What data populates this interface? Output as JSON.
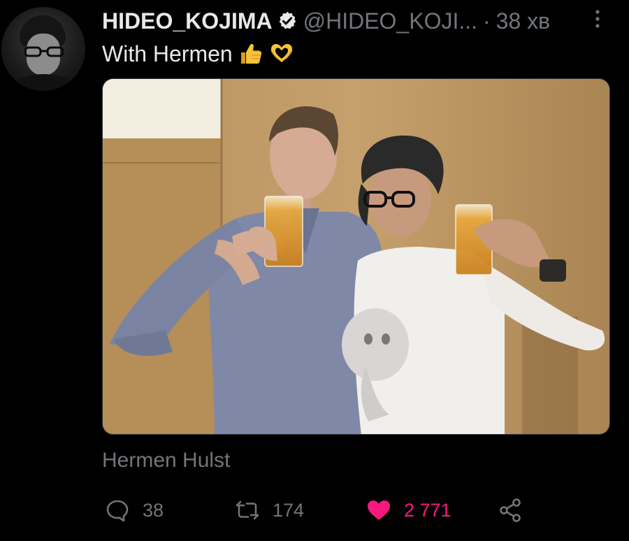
{
  "tweet": {
    "author_name": "HIDEO_KOJIMA",
    "author_handle": "@HIDEO_KOJI...",
    "separator": "·",
    "timestamp": "38 хв",
    "text": "With Hermen",
    "emojis": [
      "thumbs-up-icon",
      "heart-hands-icon"
    ],
    "media_caption": "Hermen Hulst",
    "media_description": "photo"
  },
  "actions": {
    "replies": "38",
    "retweets": "174",
    "likes": "2 771",
    "liked": true
  },
  "colors": {
    "background": "#000000",
    "text_primary": "#e7e9ea",
    "text_secondary": "#71767b",
    "like": "#f91880",
    "verified_badge": "#e7e9ea"
  }
}
